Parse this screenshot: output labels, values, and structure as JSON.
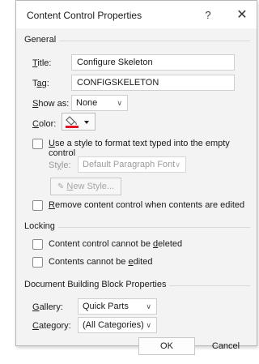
{
  "window": {
    "title": "Content Control Properties",
    "help": "?",
    "close": "✕"
  },
  "general": {
    "section": "General",
    "title_label": "Title:",
    "title_value": "Configure Skeleton",
    "tag_label": "Tag:",
    "tag_value": "CONFIGSKELETON",
    "show_as_label": "Show as:",
    "show_as_value": "None",
    "color_label": "Color:",
    "use_style_label": "Use a style to format text typed into the empty control",
    "style_label": "Style:",
    "style_value": "Default Paragraph Font",
    "new_style_label": "New Style...",
    "remove_label": "Remove content control when contents are edited"
  },
  "locking": {
    "section": "Locking",
    "cannot_delete_label": "Content control cannot be deleted",
    "cannot_edit_label": "Contents cannot be edited"
  },
  "building_block": {
    "section": "Document Building Block Properties",
    "gallery_label": "Gallery:",
    "gallery_value": "Quick Parts",
    "category_label": "Category:",
    "category_value": "(All Categories)"
  },
  "footer": {
    "ok_label": "OK",
    "cancel_label": "Cancel"
  },
  "colors": {
    "dialog_bg": "#f3f3f3",
    "color_swatch": "#e81123"
  }
}
